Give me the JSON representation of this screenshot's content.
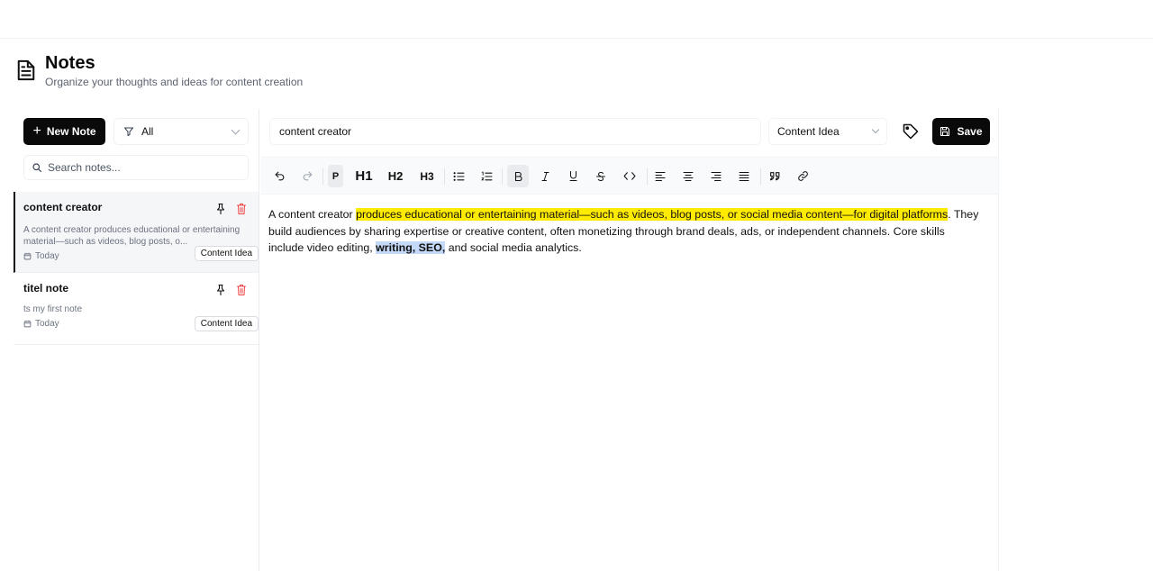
{
  "header": {
    "title": "Notes",
    "subtitle": "Organize your thoughts and ideas for content creation"
  },
  "sidebar": {
    "new_note_label": "New Note",
    "filter_value": "All",
    "search_placeholder": "Search notes..."
  },
  "notes": [
    {
      "title": "content creator",
      "snippet": "A content creator  produces educational or entertaining material—such as videos, blog posts, o...",
      "date": "Today",
      "tag": "Content Idea"
    },
    {
      "title": "titel note",
      "snippet": "ts my first note",
      "date": "Today",
      "tag": "Content Idea"
    }
  ],
  "editor": {
    "title_value": "content creator",
    "category_value": "Content Idea",
    "save_label": "Save",
    "toolbar": {
      "paragraph": "P",
      "h1": "H1",
      "h2": "H2",
      "h3": "H3"
    },
    "content": {
      "part1": "A content creator ",
      "highlight": "produces educational or entertaining material—such as videos, blog posts, or social media content—for digital platforms",
      "part2": ". They build audiences by sharing expertise or creative content, often monetizing through brand deals, ads, or independent channels. Core skills include video editing, ",
      "bold_selected": "writing, SEO,",
      "part3": " and social media analytics."
    }
  },
  "colors": {
    "accent": "#0a0a0a",
    "highlight": "#ffeb00",
    "selection": "#c4d9f7",
    "delete": "#ef4444"
  }
}
